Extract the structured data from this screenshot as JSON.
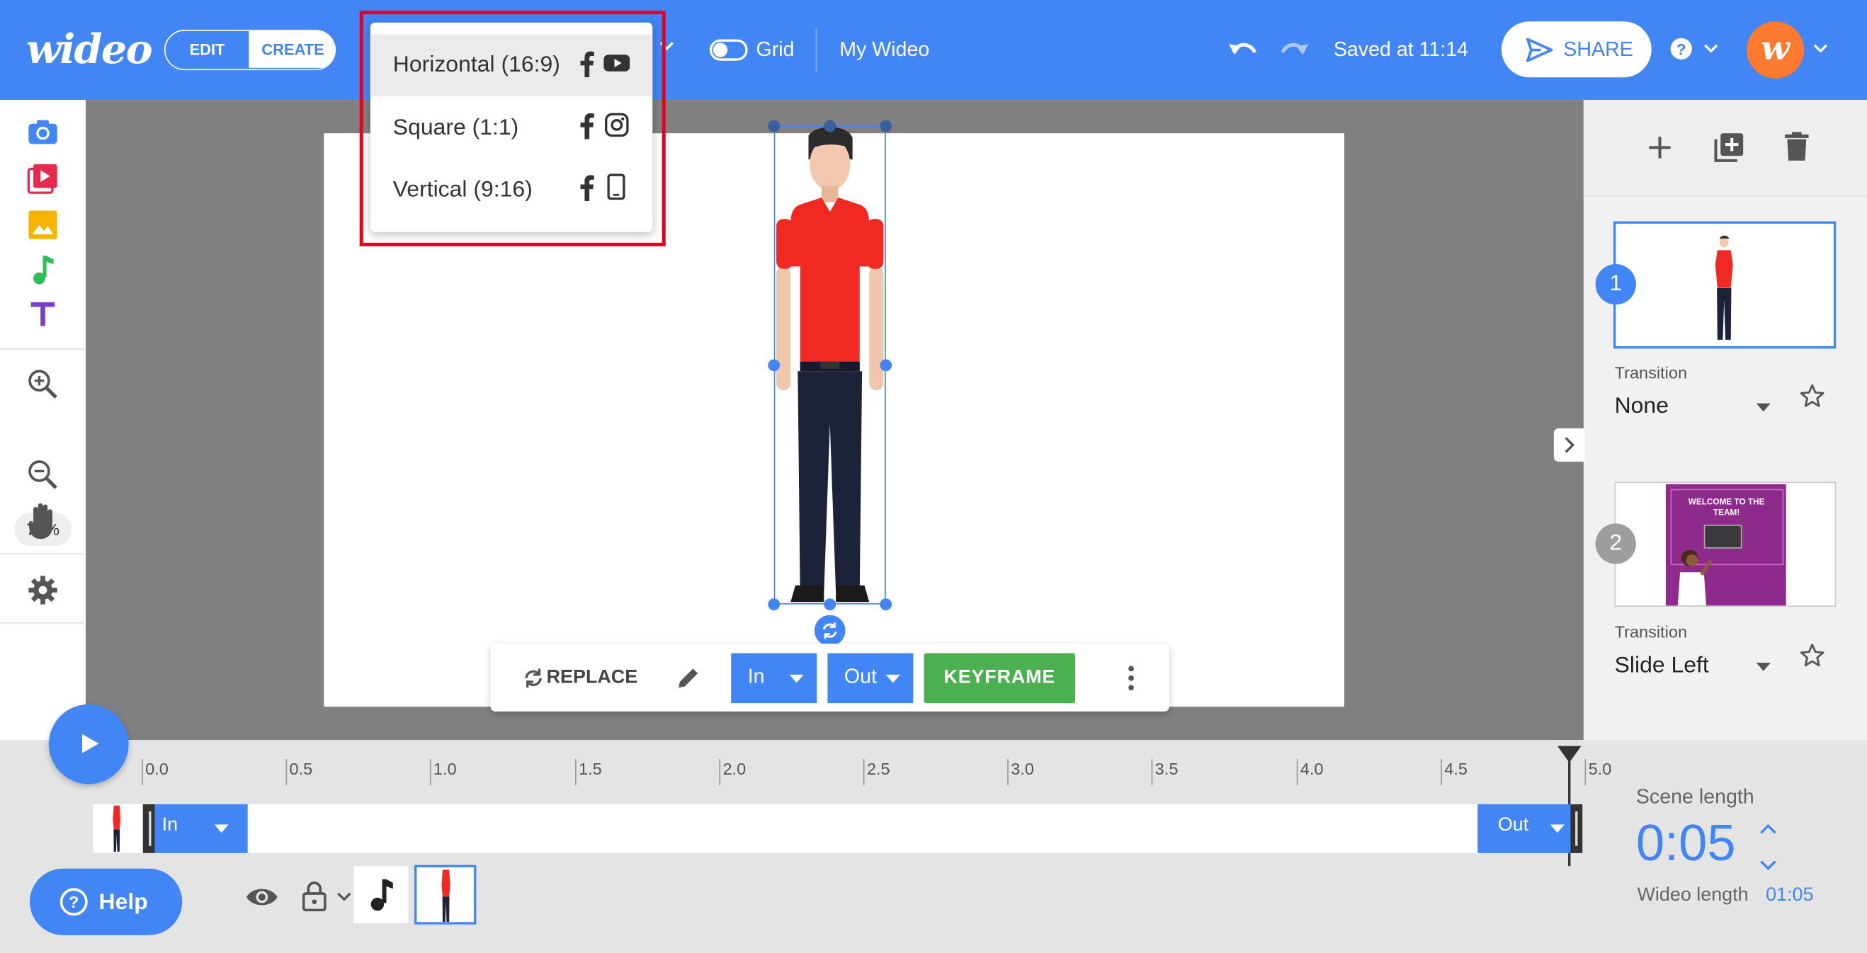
{
  "header": {
    "logo_text": "wideo",
    "mode_toggle": {
      "edit_label": "EDIT",
      "create_label": "CREATE",
      "selected": "CREATE"
    },
    "grid_label": "Grid",
    "project_title": "My Wideo",
    "save_status": "Saved at 11:14",
    "share_label": "SHARE",
    "avatar_letter": "w"
  },
  "format_menu": {
    "items": [
      {
        "label": "Horizontal (16:9)",
        "icons": [
          "facebook-icon",
          "youtube-icon"
        ],
        "active": true
      },
      {
        "label": "Square (1:1)",
        "icons": [
          "facebook-icon",
          "instagram-icon"
        ],
        "active": false
      },
      {
        "label": "Vertical (9:16)",
        "icons": [
          "facebook-icon",
          "mobile-phone-icon"
        ],
        "active": false
      }
    ]
  },
  "left_toolbar": {
    "tools": [
      "camera-icon",
      "video-icon",
      "image-icon",
      "music-icon",
      "text-icon"
    ],
    "zoom_level": "75%"
  },
  "context_toolbar": {
    "replace_label": "REPLACE",
    "in_label": "In",
    "out_label": "Out",
    "keyframe_label": "KEYFRAME"
  },
  "scenes": [
    {
      "number": "1",
      "transition_label": "Transition",
      "transition_value": "None"
    },
    {
      "number": "2",
      "transition_label": "Transition",
      "transition_value": "Slide Left",
      "thumb_text": "WELCOME TO THE TEAM!"
    }
  ],
  "timeline": {
    "ticks": [
      "0.0",
      "0.5",
      "1.0",
      "1.5",
      "2.0",
      "2.5",
      "3.0",
      "3.5",
      "4.0",
      "4.5",
      "5.0"
    ],
    "in_label": "In",
    "out_label": "Out",
    "help_label": "Help",
    "scene_length_label": "Scene length",
    "scene_length": "0:05",
    "wideo_length_label": "Wideo length",
    "wideo_length": "01:05"
  },
  "colors": {
    "brand_blue": "#4285f4",
    "keyframe_green": "#4caf50",
    "highlight_red": "#e8001c",
    "avatar_orange": "#ff7a2f"
  }
}
